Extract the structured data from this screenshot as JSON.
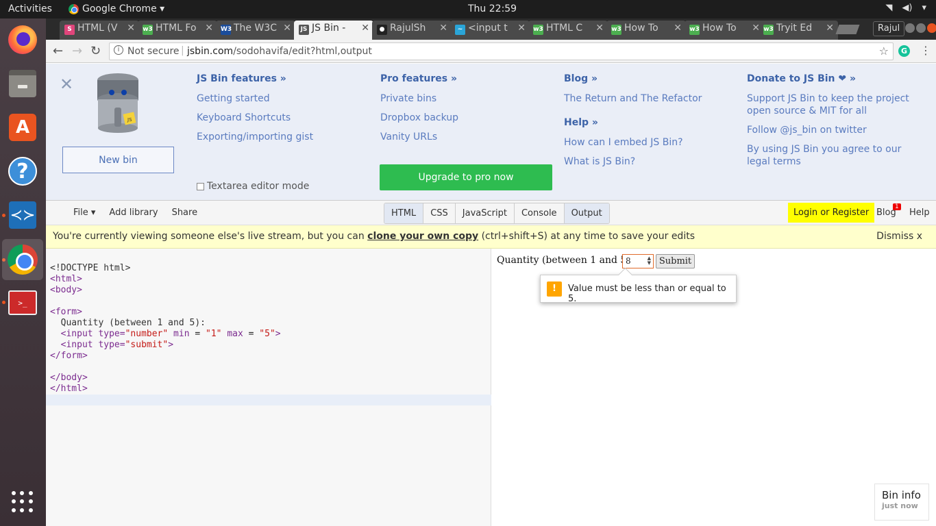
{
  "os": {
    "activities": "Activities",
    "app_name": "Google Chrome ▾",
    "clock": "Thu 22:59",
    "tray": [
      "wifi-icon",
      "volume-icon",
      "system-menu-icon"
    ]
  },
  "launcher": [
    "firefox",
    "files",
    "ubuntu-software",
    "help",
    "vscode",
    "chrome",
    "terminal",
    "show-applications"
  ],
  "browser": {
    "tabs": [
      {
        "label": "HTML (V",
        "fav": "S",
        "color": "#e0457b"
      },
      {
        "label": "HTML Fo",
        "fav": "w3",
        "color": "#4caf50"
      },
      {
        "label": "The W3C",
        "fav": "W3",
        "color": "#1b4d9c"
      },
      {
        "label": "JS Bin - ",
        "fav": "JS",
        "color": "#555555"
      },
      {
        "label": "RajulSh",
        "fav": "gh",
        "color": "#222222"
      },
      {
        "label": "<input t",
        "fav": "~",
        "color": "#2aa5d8"
      },
      {
        "label": "HTML C",
        "fav": "w3",
        "color": "#4caf50"
      },
      {
        "label": "How To",
        "fav": "w3",
        "color": "#4caf50"
      },
      {
        "label": "How To",
        "fav": "w3",
        "color": "#4caf50"
      },
      {
        "label": "Tryit Ed",
        "fav": "w3",
        "color": "#4caf50"
      }
    ],
    "active_tab": 3,
    "profile": "Rajul",
    "not_secure": "Not secure",
    "url_host": "jsbin.com",
    "url_path": "/sodohavifa/edit?html,output"
  },
  "jsbin": {
    "new_bin": "New bin",
    "textarea_mode": "Textarea editor mode",
    "upgrade": "Upgrade to pro now",
    "col1": {
      "title": "JS Bin features »",
      "links": [
        "Getting started",
        "Keyboard Shortcuts",
        "Exporting/importing gist"
      ]
    },
    "col2": {
      "title": "Pro features »",
      "links": [
        "Private bins",
        "Dropbox backup",
        "Vanity URLs"
      ]
    },
    "col3": {
      "title": "Blog »",
      "links": [
        "The Return and The Refactor"
      ],
      "title2": "Help »",
      "links2": [
        "How can I embed JS Bin?",
        "What is JS Bin?"
      ]
    },
    "col4": {
      "title": "Donate to JS Bin ❤ »",
      "links": [
        "Support JS Bin to keep the project open source & MIT for all",
        "Follow @js_bin on twitter",
        "By using JS Bin you agree to our legal terms"
      ]
    },
    "toolbar": {
      "file": "File ▾",
      "add_library": "Add library",
      "share": "Share",
      "panels": [
        "HTML",
        "CSS",
        "JavaScript",
        "Console",
        "Output"
      ],
      "login": "Login or Register",
      "blog": "Blog",
      "blog_badge": "1",
      "help": "Help"
    },
    "notice": {
      "before": "You're currently viewing someone else's live stream, but you can ",
      "link": "clone your own copy",
      "after": " (ctrl+shift+S) at any time to save your edits",
      "dismiss": "Dismiss x"
    },
    "output": {
      "label": "Quantity (between 1 and 5):",
      "input_value": "8",
      "submit": "Submit",
      "tooltip": "Value must be less than or equal to 5."
    },
    "bin_info": {
      "title": "Bin info",
      "time": "just now"
    }
  }
}
